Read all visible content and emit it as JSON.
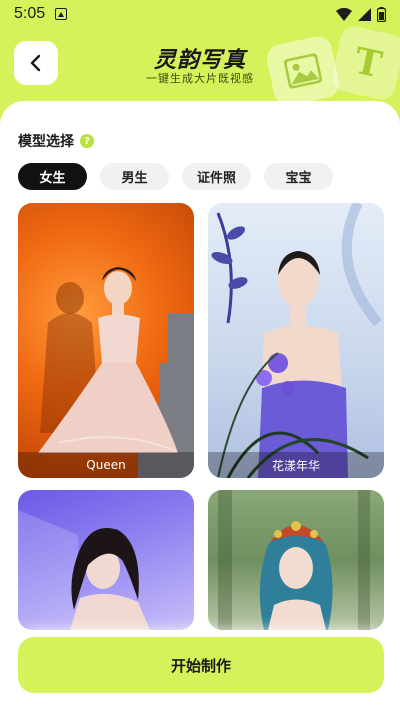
{
  "status_bar": {
    "time": "5:05"
  },
  "header": {
    "title": "灵韵写真",
    "subtitle": "一键生成大片既视感",
    "deco_letter": "T"
  },
  "model_select": {
    "title": "模型选择",
    "help_glyph": "?",
    "chips": [
      {
        "label": "女生",
        "active": true
      },
      {
        "label": "男生",
        "active": false
      },
      {
        "label": "证件照",
        "active": false
      },
      {
        "label": "宝宝",
        "active": false
      }
    ]
  },
  "styles": [
    {
      "label": "Queen"
    },
    {
      "label": "花漾年华"
    },
    {
      "label": ""
    },
    {
      "label": ""
    }
  ],
  "footer": {
    "start_label": "开始制作"
  },
  "colors": {
    "accent": "#d6f25a",
    "chip_active": "#111111",
    "chip_inactive": "#f1f1f1"
  }
}
